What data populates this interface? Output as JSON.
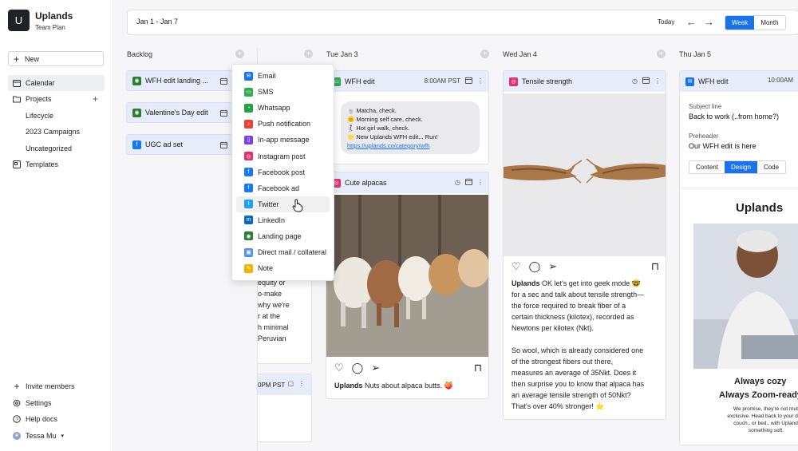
{
  "workspace": {
    "logo_letter": "U",
    "name": "Uplands",
    "plan": "Team Plan"
  },
  "sidebar": {
    "new_label": "New",
    "items": [
      {
        "label": "Calendar"
      },
      {
        "label": "Projects"
      },
      {
        "label": "Lifecycle"
      },
      {
        "label": "2023 Campaigns"
      },
      {
        "label": "Uncategorized"
      },
      {
        "label": "Templates"
      }
    ],
    "footer": [
      {
        "label": "Invite members"
      },
      {
        "label": "Settings"
      },
      {
        "label": "Help docs"
      },
      {
        "label": "Tessa Mu"
      }
    ]
  },
  "topbar": {
    "date_range": "Jan 1 - Jan 7",
    "today": "Today",
    "view_week": "Week",
    "view_month": "Month",
    "active_view": "Week"
  },
  "columns": {
    "backlog": "Backlog",
    "tue": "Tue Jan 3",
    "wed": "Wed Jan 4",
    "thu": "Thu Jan 5"
  },
  "backlog": [
    {
      "title": "WFH edit landing ..."
    },
    {
      "title": "Valentine's Day edit"
    },
    {
      "title": "UGC ad set"
    }
  ],
  "hidden_col": {
    "text_lines": [
      "equity or",
      "o-make",
      "why we're",
      "r at the",
      "h minimal",
      "Peruvian"
    ],
    "time": "0PM PST"
  },
  "dropdown": [
    {
      "label": "Email",
      "color": "#1a73e8"
    },
    {
      "label": "SMS",
      "color": "#34a853"
    },
    {
      "label": "Whatsapp",
      "color": "#25a244"
    },
    {
      "label": "Push notification",
      "color": "#ea4335"
    },
    {
      "label": "In-app message",
      "color": "#7b3fe4"
    },
    {
      "label": "Instagram post",
      "color": "#e1306c"
    },
    {
      "label": "Facebook post",
      "color": "#1877f2"
    },
    {
      "label": "Facebook ad",
      "color": "#1877f2"
    },
    {
      "label": "Twitter",
      "color": "#1da1f2"
    },
    {
      "label": "LinkedIn",
      "color": "#0a66c2"
    },
    {
      "label": "Landing page",
      "color": "#2e7d32"
    },
    {
      "label": "Direct mail / collateral",
      "color": "#5b8def"
    },
    {
      "label": "Note",
      "color": "#f2b200"
    }
  ],
  "tue": {
    "sms": {
      "title": "WFH edit",
      "time": "8:00AM PST",
      "lines": [
        "🍵 Matcha, check.",
        "🌞 Morning self care, check.",
        "🚶‍♀️ Hot girl walk, check.",
        "🌟 New Uplands WFH edit... Run!"
      ],
      "link": "https://uplands.co/category/wfh"
    },
    "ig": {
      "title": "Cute alpacas",
      "handle": "Uplands",
      "caption": " Nuts about alpaca butts. 🍑"
    }
  },
  "wed": {
    "ig": {
      "title": "Tensile strength",
      "handle": "Uplands",
      "lines": [
        " OK let's get into geek mode 🤓",
        "for a sec and talk about tensile strength—",
        "the force required to break fiber of a",
        "certain thickness (kilotex), recorded as",
        "Newtons per kilotex (Nkt).",
        "",
        "So wool, which is already considered one",
        "of the strongest fibers out there,",
        "measures an average of 35Nkt. Does it",
        "then surprise you to know that alpaca has",
        "an average tensile strength of 50Nkt?",
        "That's over 40% stronger! ⭐"
      ]
    }
  },
  "thu": {
    "email": {
      "title": "WFH edit",
      "time": "10:00AM",
      "subject_label": "Subject line",
      "subject": "Back to work (..from home?)",
      "preheader_label": "Preheader",
      "preheader": "Our WFH edit is here",
      "tabs": [
        "Content",
        "Design",
        "Code"
      ],
      "active_tab": "Design",
      "brand": "Uplands",
      "headline1": "Always cozy",
      "headline2": "Always Zoom-ready",
      "body_lines": [
        "We promise, they're not mutuall",
        "exclusive. Head back to your desk",
        "couch.. or bed.. with Uplands in",
        "something soft."
      ]
    }
  }
}
